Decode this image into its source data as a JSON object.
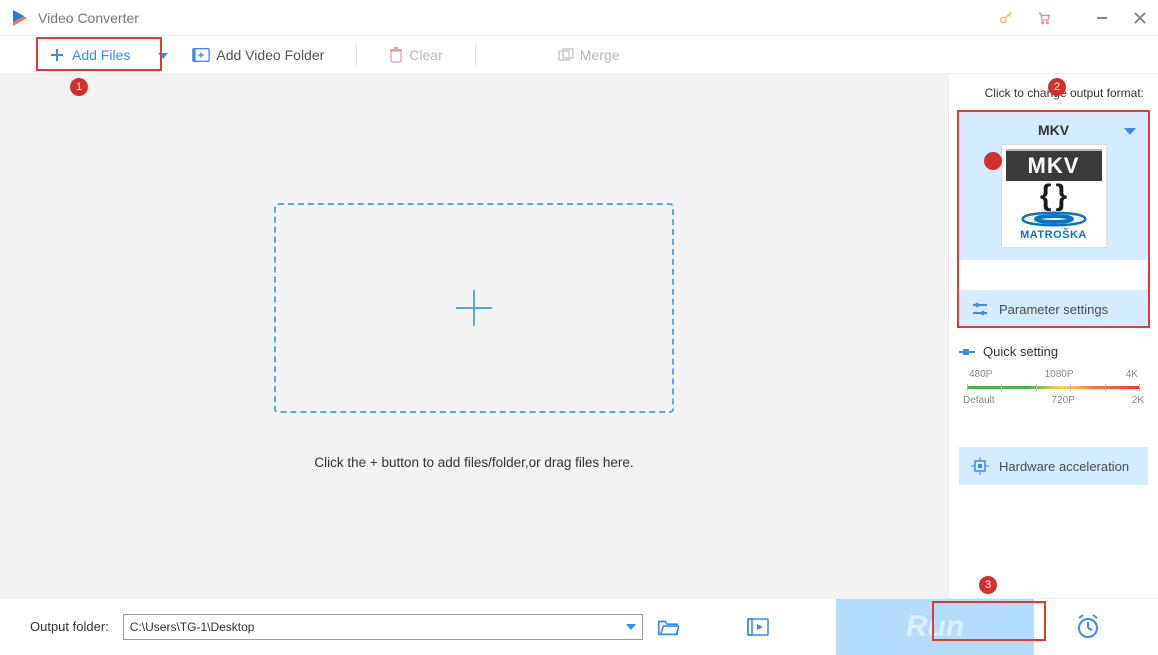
{
  "app": {
    "title": "Video Converter"
  },
  "toolbar": {
    "add_files": "Add Files",
    "add_folder": "Add Video Folder",
    "clear": "Clear",
    "merge": "Merge"
  },
  "dropzone": {
    "hint": "Click the + button to add files/folder,or drag files here."
  },
  "sidebar": {
    "change_label": "Click to change output format:",
    "format": {
      "name": "MKV",
      "badge": "MKV",
      "subtitle": "MATROŠKA"
    },
    "parameter_btn": "Parameter settings",
    "quick": {
      "title": "Quick setting",
      "top": [
        "480P",
        "1080P",
        "4K"
      ],
      "bottom": [
        "Default",
        "720P",
        "2K"
      ]
    },
    "hw_btn": "Hardware acceleration"
  },
  "bottom": {
    "label": "Output folder:",
    "path": "C:\\Users\\TG-1\\Desktop",
    "run": "Run"
  },
  "markers": {
    "m1": "1",
    "m2": "2",
    "m3": "3"
  }
}
